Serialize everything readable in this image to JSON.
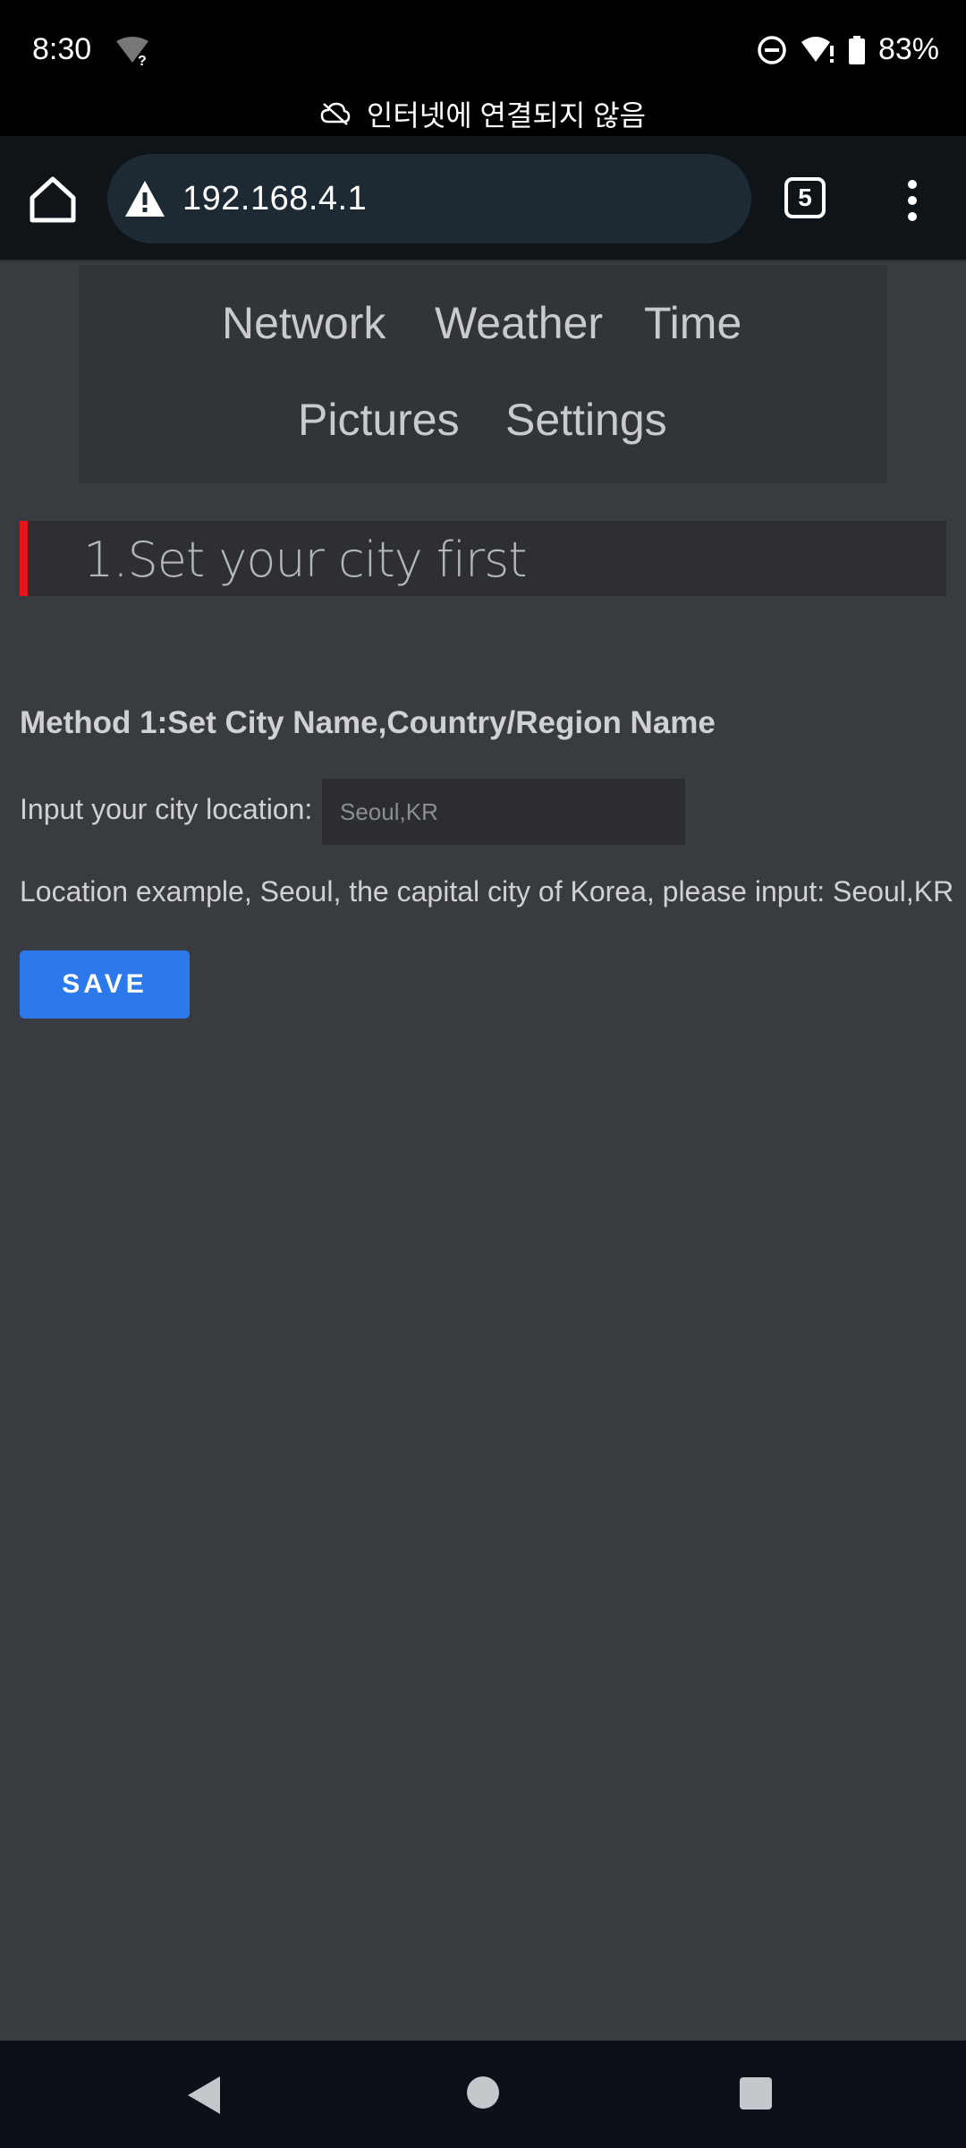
{
  "status_bar": {
    "time": "8:30",
    "battery": "83%",
    "network_banner": "인터넷에 연결되지 않음"
  },
  "browser": {
    "url": "192.168.4.1",
    "tab_count": "5"
  },
  "nav": {
    "items": [
      "Network",
      "Weather",
      "Time",
      "Pictures",
      "Settings"
    ]
  },
  "section": {
    "title": "1.Set your city first"
  },
  "form": {
    "method_title": "Method 1:Set City Name,Country/Region Name",
    "input_label": "Input your city location:",
    "input_placeholder": "Seoul,KR",
    "example": "Location example, Seoul, the capital city of Korea, please input: Seoul,KR",
    "save_label": "SAVE"
  },
  "colors": {
    "accent_red": "#e8141c",
    "button_blue": "#2b79ea",
    "background": "#383b40"
  }
}
